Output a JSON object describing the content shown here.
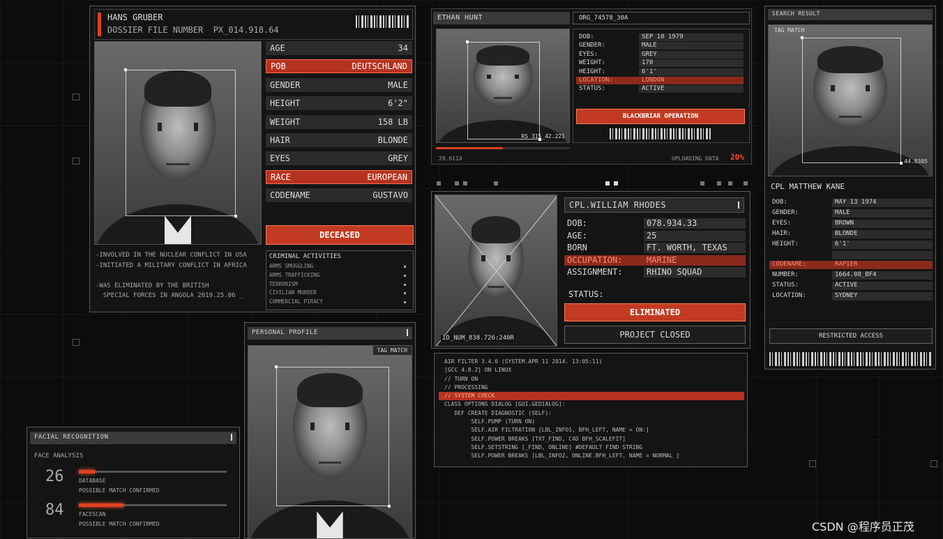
{
  "gruber": {
    "name": "HANS GRUBER",
    "dossier": "DOSSIER FILE NUMBER  PX_014.918.64",
    "fields": [
      {
        "k": "AGE",
        "v": "34",
        "hl": false
      },
      {
        "k": "POB",
        "v": "DEUTSCHLAND",
        "hl": true
      },
      {
        "k": "GENDER",
        "v": "MALE",
        "hl": false
      },
      {
        "k": "HEIGHT",
        "v": "6'2\"",
        "hl": false
      },
      {
        "k": "WEIGHT",
        "v": "158 LB",
        "hl": false
      },
      {
        "k": "HAIR",
        "v": "BLONDE",
        "hl": false
      },
      {
        "k": "EYES",
        "v": "GREY",
        "hl": false
      },
      {
        "k": "RACE",
        "v": "EUROPEAN",
        "hl": true
      },
      {
        "k": "CODENAME",
        "v": "GUSTAVO",
        "hl": false
      }
    ],
    "status": "DECEASED",
    "notes": [
      "-INVOLVED IN THE NUCLEAR CONFLICT IN USA",
      "-INITIATED A MILITARY CONFLICT IN AFRICA",
      "",
      "-WAS ELIMINATED BY THE BRITISH",
      "  SPECIAL FORCES IN ANGOLA 2019.25.06 _"
    ],
    "criminal_title": "CRIMINAL ACTIVITIES",
    "criminal": [
      "ARMS SMUGGLING",
      "ARMS TRAFFICKING",
      "TERRORISM",
      "CIVILIAN MURDER",
      "COMMERCIAL PIRACY"
    ]
  },
  "hunt": {
    "name": "ETHAN HUNT",
    "org": "ORG_74578_30A",
    "fields": [
      {
        "k": "DOB:",
        "v": "SEP 10 1979",
        "hl": false
      },
      {
        "k": "GENDER:",
        "v": "MALE",
        "hl": false
      },
      {
        "k": "EYES:",
        "v": "GREY",
        "hl": false
      },
      {
        "k": "WEIGHT:",
        "v": "170",
        "hl": false
      },
      {
        "k": "HEIGHT:",
        "v": "6'1'",
        "hl": false
      },
      {
        "k": "LOCATION:",
        "v": "LONDON",
        "hl": true
      },
      {
        "k": "STATUS:",
        "v": "ACTIVE",
        "hl": false
      }
    ],
    "op_button": "BLACKBRIAR OPERATION",
    "photo_id": "RS_315_42.221",
    "coord": "29.6114",
    "upload_label": "UPLOADING DATA",
    "upload_pct": "20%",
    "upload_value": 0.2
  },
  "search": {
    "title": "SEARCH RESULT",
    "tag": "TAG MATCH",
    "score": "44.8305",
    "name": "CPL MATTHEW KANE",
    "fields": [
      {
        "k": "DOB:",
        "v": "MAY 13 1974",
        "hl": false
      },
      {
        "k": "GENDER:",
        "v": "MALE",
        "hl": false
      },
      {
        "k": "EYES:",
        "v": "BROWN",
        "hl": false
      },
      {
        "k": "HAIR:",
        "v": "BLONDE",
        "hl": false
      },
      {
        "k": "HEIGHT:",
        "v": "6'1'",
        "hl": false
      },
      {
        "k": "",
        "v": "",
        "hl": false
      },
      {
        "k": "CODENAME:",
        "v": "RAPIER",
        "hl": true
      },
      {
        "k": "NUMBER:",
        "v": "1664.08_BF4",
        "hl": false
      },
      {
        "k": "STATUS:",
        "v": "ACTIVE",
        "hl": false
      },
      {
        "k": "LOCATION:",
        "v": "SYDNEY",
        "hl": false
      }
    ],
    "button": "RESTRICTED ACCESS"
  },
  "rhodes": {
    "name": "CPL.WILLIAM RHODES",
    "fields": [
      {
        "k": "DOB:",
        "v": "078.934.33",
        "hl": false
      },
      {
        "k": "AGE:",
        "v": "25",
        "hl": false
      },
      {
        "k": "BORN",
        "v": "FT. WORTH, TEXAS",
        "hl": false
      },
      {
        "k": "OCCUPATION:",
        "v": "MARINE",
        "hl": true
      },
      {
        "k": "ASSIGNMENT:",
        "v": "RHINO SQUAD",
        "hl": false
      }
    ],
    "status_label": "STATUS:",
    "status": "ELIMINATED",
    "project": "PROJECT CLOSED",
    "id_num": "ID_NUM_838.726:240R"
  },
  "code": {
    "lines": [
      "AIR FILTER 3.4.0 (SYSTEM.APR 11 2014. 13:05:11)",
      "[GCC 4.8.2] ON LINUX",
      "// TURN ON",
      "// PROCESSING",
      "// SYSTEM CHECK",
      "CLASS OPTIONS DIALOG [GUI.GEDIALOG]:",
      "   DEF CREATE DIAGNOSTIC (SELF):",
      "        SELF.PUMP (TURN ON)",
      "        SELF.AIR FILTRATION [LBL_INFO1, BFH_LEFT, NAME = ON:]",
      "        SELF.POWER BREAKS [TXT_FIND, C4D BFH_SCALEFIT]",
      "        SELF.SETSTRING [_FIND, ONLINE] #DEFAULT FIND STRING",
      "        SELF.POWER BREAKS [LBL_INFO2, ONLINE.BFH_LEFT, NAME = NORMAL ]"
    ],
    "highlight_index": 4
  },
  "profile": {
    "title": "PERSONAL PROFILE",
    "tag": "TAG MATCH"
  },
  "facial": {
    "title": "FACIAL RECOGNITION",
    "subtitle": "FACE ANALYSIS",
    "items": [
      {
        "num": "26",
        "label": "DATABASE",
        "sub": "POSSIBLE MATCH CONFIRMED",
        "fill": 0.11
      },
      {
        "num": "84",
        "label": "FACESCAN",
        "sub": "POSSIBLE MATCH CONFIRMED",
        "fill": 0.3
      }
    ]
  },
  "watermark": "CSDN @程序员正茂",
  "colors": {
    "accent": "#c23a22",
    "panel": "#141414",
    "bg": "#0c0c0c"
  }
}
